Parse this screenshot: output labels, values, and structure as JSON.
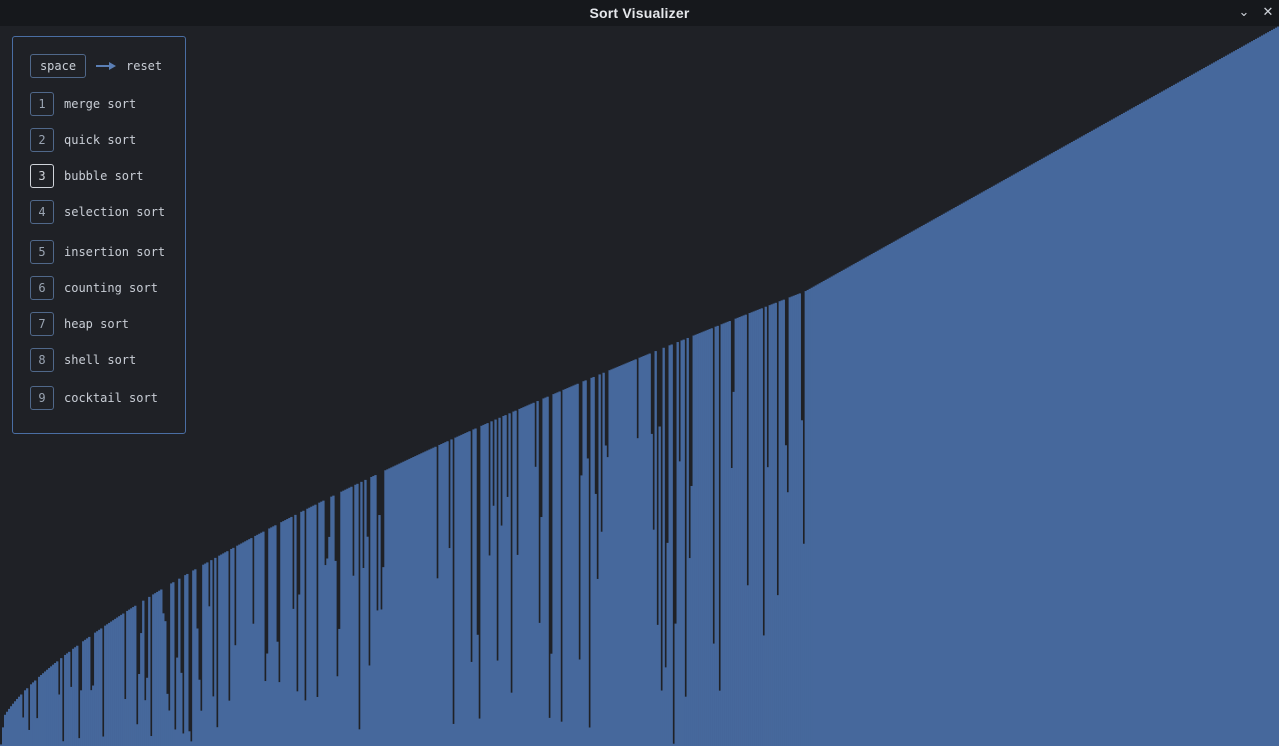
{
  "window": {
    "title": "Sort Visualizer",
    "minimize_icon": "chevron-down-icon",
    "close_icon": "close-icon"
  },
  "colors": {
    "background": "#1f2126",
    "titlebar": "#16181c",
    "bar": "#46689c",
    "panel_border": "#4a6ea3"
  },
  "controls": {
    "reset": {
      "key": "space",
      "label": "reset",
      "arrow_icon": "arrow-right-icon"
    },
    "algorithms": [
      {
        "key": "1",
        "label": "merge sort",
        "active": false
      },
      {
        "key": "2",
        "label": "quick sort",
        "active": false
      },
      {
        "key": "3",
        "label": "bubble sort",
        "active": true
      },
      {
        "key": "4",
        "label": "selection sort",
        "active": false
      },
      {
        "key": "5",
        "label": "insertion sort",
        "active": false
      },
      {
        "key": "6",
        "label": "counting sort",
        "active": false
      },
      {
        "key": "7",
        "label": "heap sort",
        "active": false
      },
      {
        "key": "8",
        "label": "shell sort",
        "active": false
      },
      {
        "key": "9",
        "label": "cocktail sort",
        "active": false
      }
    ]
  },
  "visualization": {
    "bar_count": 639,
    "sorted_fraction": 0.37
  }
}
